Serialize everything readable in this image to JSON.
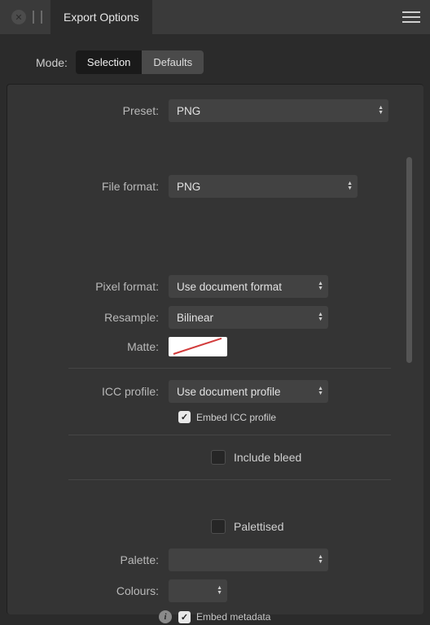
{
  "header": {
    "title": "Export Options"
  },
  "mode": {
    "label": "Mode:",
    "selection": "Selection",
    "defaults": "Defaults"
  },
  "preset": {
    "label": "Preset:",
    "value": "PNG"
  },
  "file_format": {
    "label": "File format:",
    "value": "PNG"
  },
  "pixel_format": {
    "label": "Pixel format:",
    "value": "Use document format"
  },
  "resample": {
    "label": "Resample:",
    "value": "Bilinear"
  },
  "matte": {
    "label": "Matte:"
  },
  "icc_profile": {
    "label": "ICC profile:",
    "value": "Use document profile"
  },
  "embed_icc": "Embed ICC profile",
  "include_bleed": "Include bleed",
  "palettised": "Palettised",
  "palette": {
    "label": "Palette:",
    "value": ""
  },
  "colours": {
    "label": "Colours:",
    "value": ""
  },
  "embed_metadata": "Embed metadata",
  "icons": {
    "close": "close-icon",
    "grip": "grip-icon",
    "menu": "hamburger-icon",
    "info": "info-icon"
  }
}
